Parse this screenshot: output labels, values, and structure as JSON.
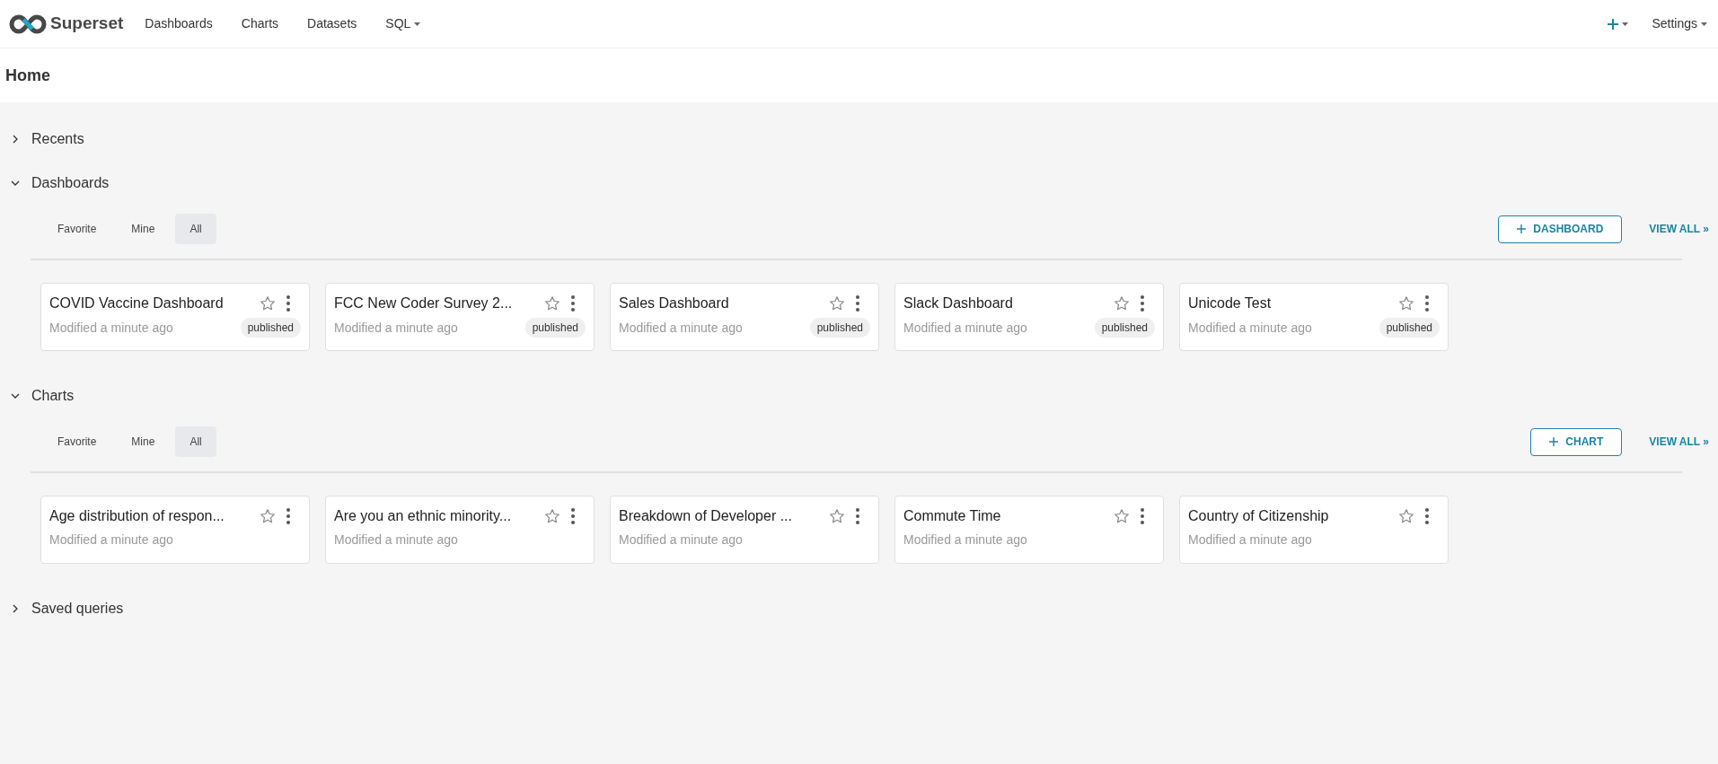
{
  "navbar": {
    "logo_text": "Superset",
    "items": [
      {
        "label": "Dashboards",
        "has_caret": false
      },
      {
        "label": "Charts",
        "has_caret": false
      },
      {
        "label": "Datasets",
        "has_caret": false
      },
      {
        "label": "SQL",
        "has_caret": true
      }
    ],
    "settings": {
      "label": "Settings",
      "has_caret": true
    }
  },
  "page": {
    "title": "Home"
  },
  "sections": [
    {
      "title": "Recents",
      "expanded": false
    },
    {
      "title": "Dashboards",
      "expanded": true,
      "tabs": [
        {
          "label": "Favorite",
          "selected": false
        },
        {
          "label": "Mine",
          "selected": false
        },
        {
          "label": "All",
          "selected": true
        }
      ],
      "new_button": "DASHBOARD",
      "view_all": "VIEW ALL »",
      "cards": [
        {
          "title": "COVID Vaccine Dashboard",
          "subtitle": "Modified a minute ago",
          "badge": "published",
          "starred": false
        },
        {
          "title": "FCC New Coder Survey 2...",
          "subtitle": "Modified a minute ago",
          "badge": "published",
          "starred": false
        },
        {
          "title": "Sales Dashboard",
          "subtitle": "Modified a minute ago",
          "badge": "published",
          "starred": false
        },
        {
          "title": "Slack Dashboard",
          "subtitle": "Modified a minute ago",
          "badge": "published",
          "starred": false
        },
        {
          "title": "Unicode Test",
          "subtitle": "Modified a minute ago",
          "badge": "published",
          "starred": false
        }
      ]
    },
    {
      "title": "Charts",
      "expanded": true,
      "tabs": [
        {
          "label": "Favorite",
          "selected": false
        },
        {
          "label": "Mine",
          "selected": false
        },
        {
          "label": "All",
          "selected": true
        }
      ],
      "new_button": "CHART",
      "view_all": "VIEW ALL »",
      "cards": [
        {
          "title": "Age distribution of respon...",
          "subtitle": "Modified a minute ago",
          "starred": false
        },
        {
          "title": "Are you an ethnic minority...",
          "subtitle": "Modified a minute ago",
          "starred": false
        },
        {
          "title": "Breakdown of Developer ...",
          "subtitle": "Modified a minute ago",
          "starred": false
        },
        {
          "title": "Commute Time",
          "subtitle": "Modified a minute ago",
          "starred": false
        },
        {
          "title": "Country of Citizenship",
          "subtitle": "Modified a minute ago",
          "starred": false
        }
      ]
    },
    {
      "title": "Saved queries",
      "expanded": false
    }
  ]
}
